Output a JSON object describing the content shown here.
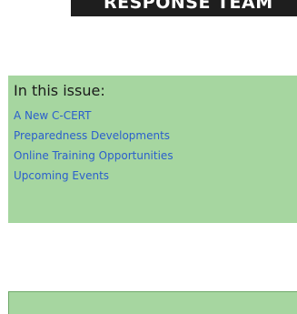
{
  "banner": {
    "text": "RESPONSE TEAM"
  },
  "issue_box": {
    "title": "In this issue:",
    "items": [
      "A New C-CERT",
      "Preparedness Developments",
      "Online Training Opportunities",
      "Upcoming Events"
    ]
  },
  "colors": {
    "banner_bg": "#1e1e1e",
    "box_bg": "#a6d6a0",
    "link": "#2b5fcc"
  }
}
